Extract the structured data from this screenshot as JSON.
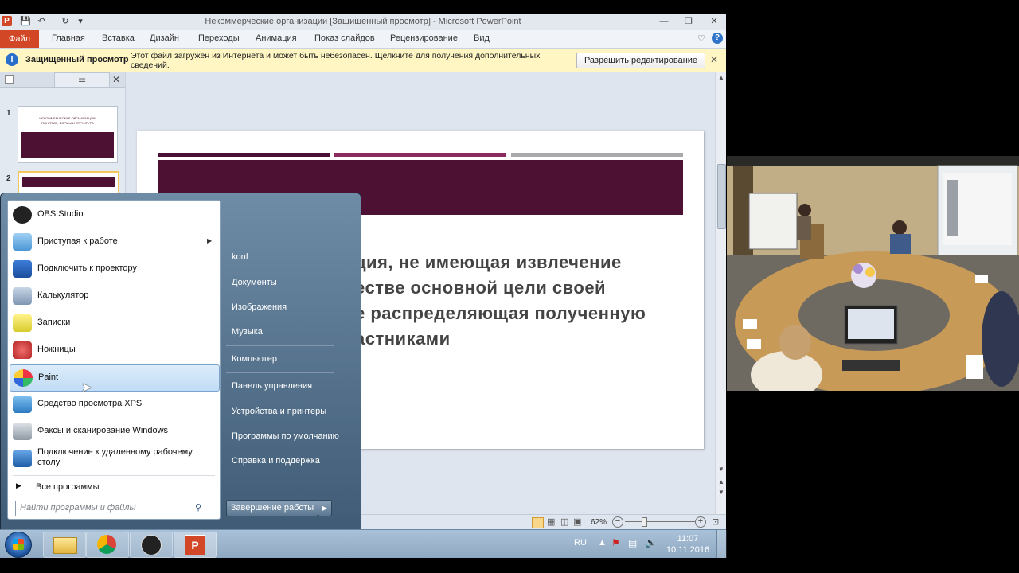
{
  "window": {
    "title": "Некоммерческие организации [Защищенный просмотр] - Microsoft PowerPoint",
    "app_icon": "P"
  },
  "ribbon": {
    "tabs": [
      "Файл",
      "Главная",
      "Вставка",
      "Дизайн",
      "Переходы",
      "Анимация",
      "Показ слайдов",
      "Рецензирование",
      "Вид"
    ]
  },
  "infobar": {
    "heading": "Защищенный просмотр",
    "message_line1": "Этот файл загружен из Интернета и может быть небезопасен. Щелкните для получения дополнительных",
    "message_line2": "сведений.",
    "button": "Разрешить редактирование"
  },
  "slides_pane": {
    "numbers": [
      "1",
      "2"
    ],
    "thumb1_title_line1": "НЕКОММЕРЧЕСКИЕ ОРГАНИЗАЦИИ:",
    "thumb1_title_line2": "ПОНЯТИЕ, ФОРМЫ И СТРУКТУРА"
  },
  "slide": {
    "lines": [
      "ция,  не  имеющая  извлечение",
      "естве  основной  цели  своей",
      "е распределяющая полученную",
      "астниками"
    ],
    "bar_colors": [
      "#4a1035",
      "#8a2c5e",
      "#a9a9ad"
    ],
    "banner_color": "#4d1233"
  },
  "statusbar": {
    "zoom": "62%"
  },
  "start_menu": {
    "programs": [
      {
        "label": "OBS Studio"
      },
      {
        "label": "Приступая к работе",
        "submenu": true
      },
      {
        "label": "Подключить к проектору"
      },
      {
        "label": "Калькулятор"
      },
      {
        "label": "Записки"
      },
      {
        "label": "Ножницы"
      },
      {
        "label": "Paint",
        "selected": true
      },
      {
        "label": "Средство просмотра XPS"
      },
      {
        "label": "Факсы и сканирование Windows"
      },
      {
        "label": "Подключение к удаленному рабочему",
        "label2": "столу"
      }
    ],
    "all_programs": "Все программы",
    "search_placeholder": "Найти программы и файлы",
    "right_items": [
      "konf",
      "Документы",
      "Изображения",
      "Музыка",
      "Компьютер",
      "Панель управления",
      "Устройства и принтеры",
      "Программы по умолчанию",
      "Справка и поддержка"
    ],
    "shutdown": "Завершение работы"
  },
  "taskbar": {
    "lang": "RU",
    "time": "11:07",
    "date": "10.11.2016"
  }
}
